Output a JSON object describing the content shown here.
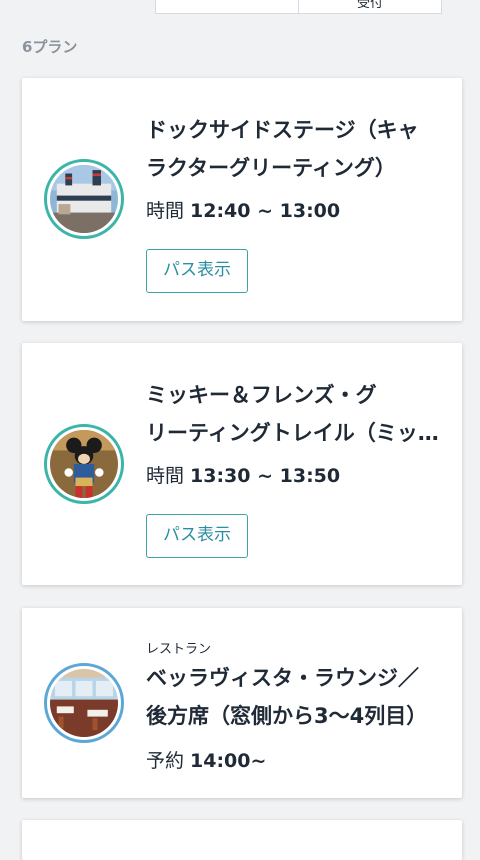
{
  "top_tabs": {
    "right_label": "受付"
  },
  "plan_count": "6プラン",
  "cards": [
    {
      "category": "",
      "title_line1": "ドックサイドステージ（キャ",
      "title_line2": "ラクターグリーティング）",
      "time_label": "時間",
      "time_value": "12:40 ~ 13:00",
      "button_label": "パス表示"
    },
    {
      "category": "",
      "title_line1": "ミッキー＆フレンズ・グ",
      "title_line2": "リーティングトレイル（ミッ…",
      "time_label": "時間",
      "time_value": "13:30 ~ 13:50",
      "button_label": "パス表示"
    },
    {
      "category": "レストラン",
      "title_line1": "ベッラヴィスタ・ラウンジ／",
      "title_line2": "後方席（窓側から3〜4列目）",
      "time_label": "予約",
      "time_value": "14:00~"
    }
  ],
  "colors": {
    "accent_teal": "#3bb5a8",
    "accent_blue": "#5aa7d8",
    "button_text": "#2a8fa0",
    "background": "#f1f2f4"
  }
}
